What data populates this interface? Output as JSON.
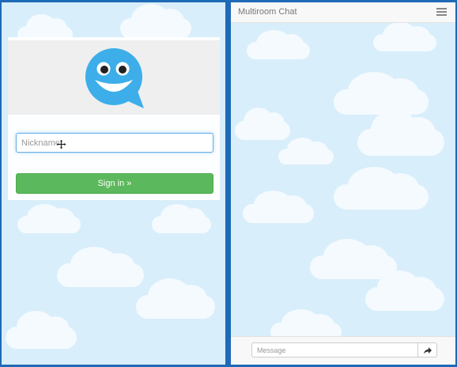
{
  "app": {
    "title": "Multiroom Chat"
  },
  "login": {
    "nickname_placeholder": "Nickname",
    "signin_label": "Sign in »"
  },
  "chat": {
    "message_placeholder": "Message"
  },
  "colors": {
    "background_sky": "#d8eefb",
    "divider_blue": "#1e6ab7",
    "signin_green": "#5cb85c",
    "logo_blue": "#3daee9",
    "input_focus_blue": "#66afe9"
  },
  "icons": {
    "logo": "smiley-speech-bubble-icon",
    "cursor": "move-cursor-icon",
    "menu": "hamburger-menu-icon",
    "send": "share-arrow-icon"
  }
}
